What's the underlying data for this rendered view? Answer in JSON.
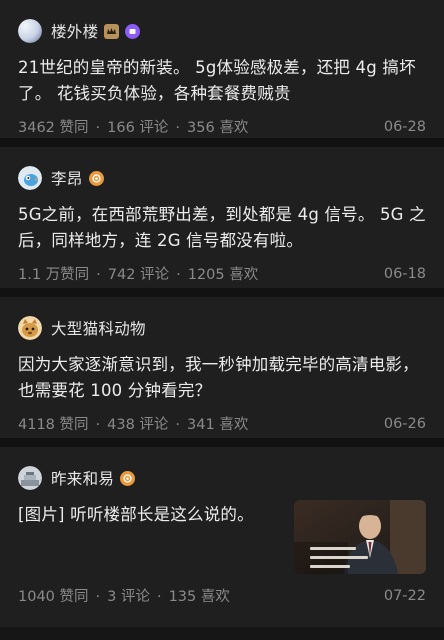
{
  "posts": [
    {
      "author": "楼外楼",
      "avatar_icon": "avatar-blue-gradient",
      "badges": [
        "level-badge-icon",
        "purple-badge-icon"
      ],
      "content": "21世纪的皇帝的新装。 5g体验感极差，还把 4g 搞坏了。 花钱买负体验，各种套餐费贼贵",
      "likes": "3462 赞同",
      "comments": "166 评论",
      "favorites": "356 喜欢",
      "date": "06-28"
    },
    {
      "author": "李昂",
      "avatar_icon": "avatar-bird",
      "badges": [
        "orange-badge-icon"
      ],
      "content": "5G之前，在西部荒野出差，到处都是 4g 信号。 5G 之后，同样地方，连 2G 信号都没有啦。",
      "likes": "1.1 万赞同",
      "comments": "742 评论",
      "favorites": "1205 喜欢",
      "date": "06-18"
    },
    {
      "author": "大型猫科动物",
      "avatar_icon": "avatar-cat",
      "badges": [],
      "content": "因为大家逐渐意识到，我一秒钟加载完毕的高清电影，也需要花 100 分钟看完？",
      "likes": "4118 赞同",
      "comments": "438 评论",
      "favorites": "341 喜欢",
      "date": "06-26"
    },
    {
      "author": "昨来和易",
      "avatar_icon": "avatar-photo",
      "badges": [
        "orange-badge-icon"
      ],
      "content": "[图片] 听听楼部长是这么说的。",
      "likes": "1040 赞同",
      "comments": "3 评论",
      "favorites": "135 喜欢",
      "date": "07-22",
      "thumbnail": "video-thumbnail"
    }
  ],
  "separator": "·"
}
